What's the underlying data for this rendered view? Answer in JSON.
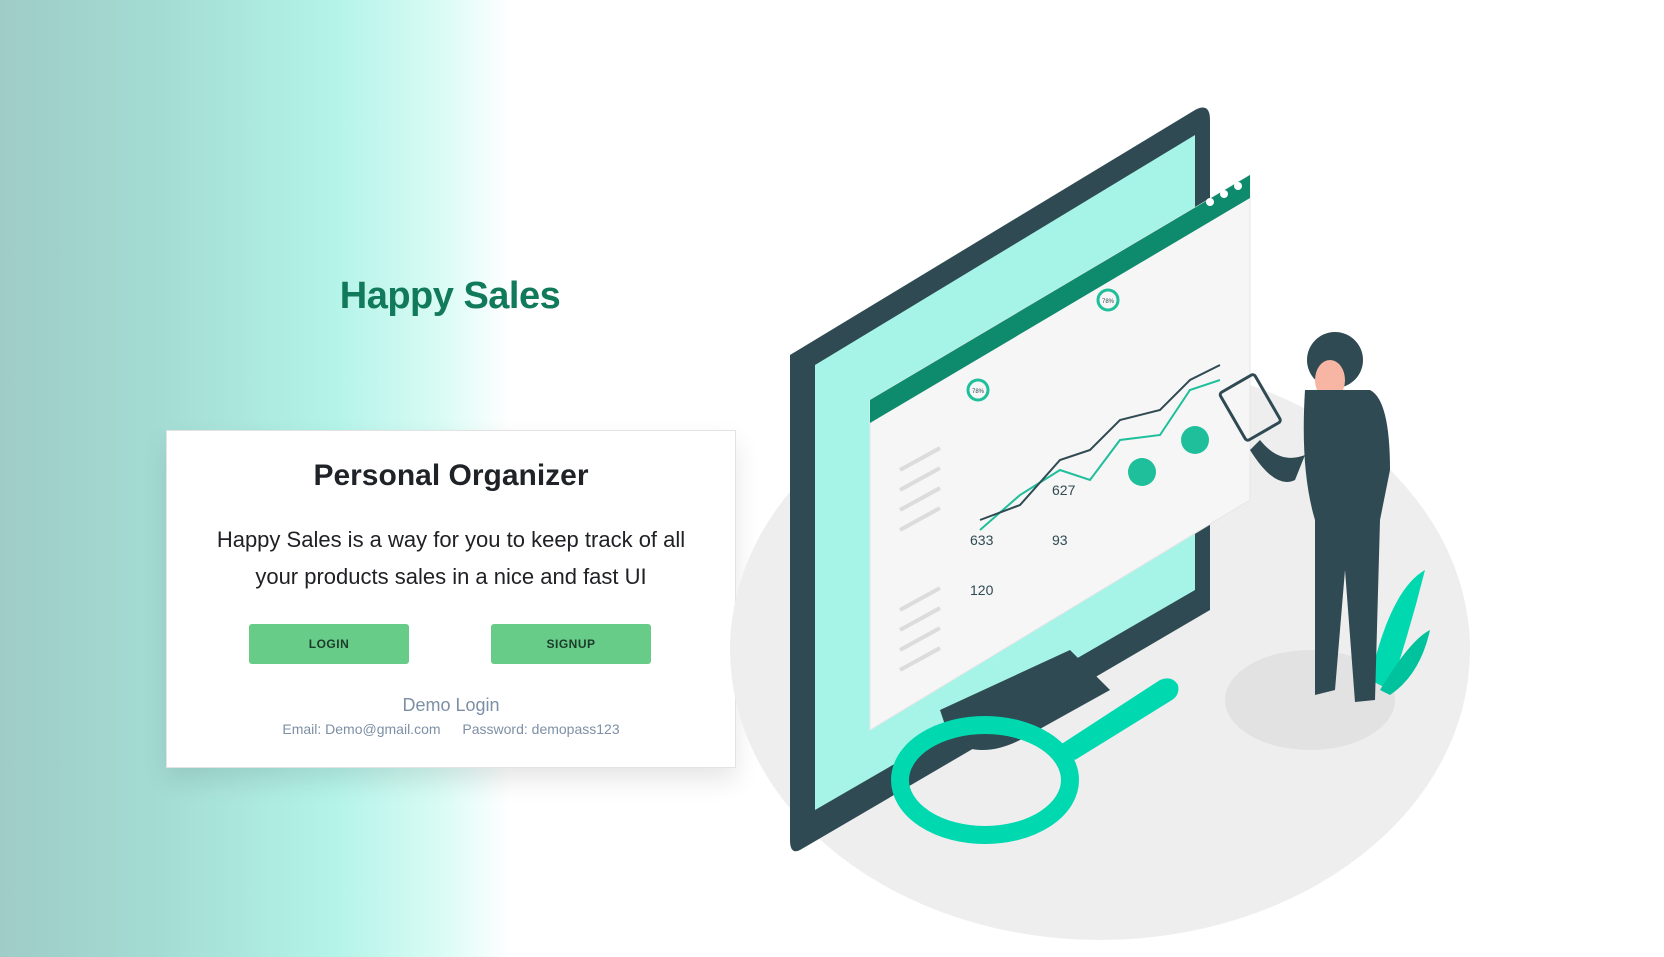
{
  "brand": {
    "title": "Happy Sales"
  },
  "card": {
    "title": "Personal Organizer",
    "description": "Happy Sales is a way for you to keep track of all your products sales in a nice and fast UI",
    "login_label": "LOGIN",
    "signup_label": "SIGNUP",
    "demo": {
      "title": "Demo Login",
      "email": "Email: Demo@gmail.com",
      "password": "Password: demopass123"
    }
  },
  "illustration": {
    "stat_labels": [
      "627",
      "633",
      "93",
      "120"
    ],
    "gauge_labels": [
      "78%",
      "78%"
    ]
  },
  "colors": {
    "brand_green": "#107a5a",
    "button_green": "#66cc88",
    "teal_accent": "#00d8b0",
    "monitor_dark": "#2f4a52"
  }
}
